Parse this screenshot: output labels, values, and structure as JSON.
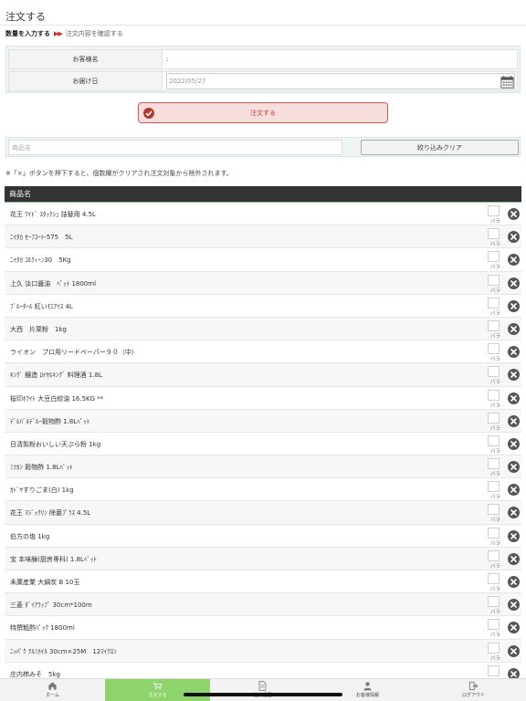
{
  "page": {
    "title": "注文する",
    "steps": {
      "current": "数量を入力する",
      "arrows": "▶▶",
      "next": "注文内容を確認する"
    }
  },
  "info": {
    "customer_label": "お客様名",
    "customer_value": ":",
    "delivery_label": "お届け日",
    "delivery_value": "2022/05/27"
  },
  "order_button": "注文する",
  "filter": {
    "placeholder": "商品名",
    "clear_label": "絞り込みクリア"
  },
  "notice": "※「×」ボタンを押下すると、個数欄がクリアされ注文対象から除外されます。",
  "product_header": "商品名",
  "unit_label": "バラ",
  "products": [
    "花王 ﾜｲﾄﾞ ｽﾀｯｸｼｭ 詰替用 4.5L",
    "ﾆｲﾀｶ ｾｰﾌｺｰﾄ-575　5L",
    "ﾆｲﾀｶ ｺﾙｸｨｰﾝ30　5Kg",
    "上久 淡口醤油　ﾍﾟｯﾄ 1800ml",
    "ﾌﾞﾙｰﾀｰﾙ 紅いﾓｴｱｲｽ 4L",
    "大西　片栗粉　1kg",
    "ライオン　プロ用リードペーパー９０（中）",
    "ｷﾝｸﾞ 醸造 ﾛｲﾔﾙｷﾝｸﾞ 料理酒 1.8L",
    "桜印ﾎﾜｲﾄ 大豆白絞油 16.5KG **",
    "ﾃﾞﾙﾊﾞﾙﾃﾞﾙｰ穀物酢 1.8Lﾍﾟｯﾄ",
    "日清製粉おいしい天ぷら粉 1kg",
    "ﾐﾂｶﾝ 穀物酢 1.8Lﾍﾟｯﾄ",
    "ｶﾄﾞﾔすりごま(白) 1kg",
    "花王 ﾏｼﾞｯｸﾘﾝ 除菌ﾌﾟﾗｽ 4.5L",
    "伯方の塩 1kg",
    "宝 本味醂(厨房専科) 1.8Lﾍﾟｯﾄ",
    "未廣産業 大鍋炭 B 10玉",
    "三菱 ﾀﾞｲｱﾗｯﾌﾟ 30cm*100m",
    "特撰粗酢ﾊﾟｯｸ 1800ml",
    "ﾆｯﾊﾟｸ ｱﾙﾐﾎｲﾙ 30cm×25M　12ﾏｲｸﾛﾝ",
    "庄内柿みそ　5kg"
  ],
  "tabs": [
    {
      "label": "ホーム",
      "icon": "home-icon"
    },
    {
      "label": "注文する",
      "icon": "cart-icon"
    },
    {
      "label": "注文履歴",
      "icon": "document-icon"
    },
    {
      "label": "お客様情報",
      "icon": "person-icon"
    },
    {
      "label": "ログアウト",
      "icon": "logout-icon"
    }
  ],
  "colors": {
    "accent": "#8ed36b",
    "order_border": "#d9534f",
    "header_bg": "#333333"
  }
}
